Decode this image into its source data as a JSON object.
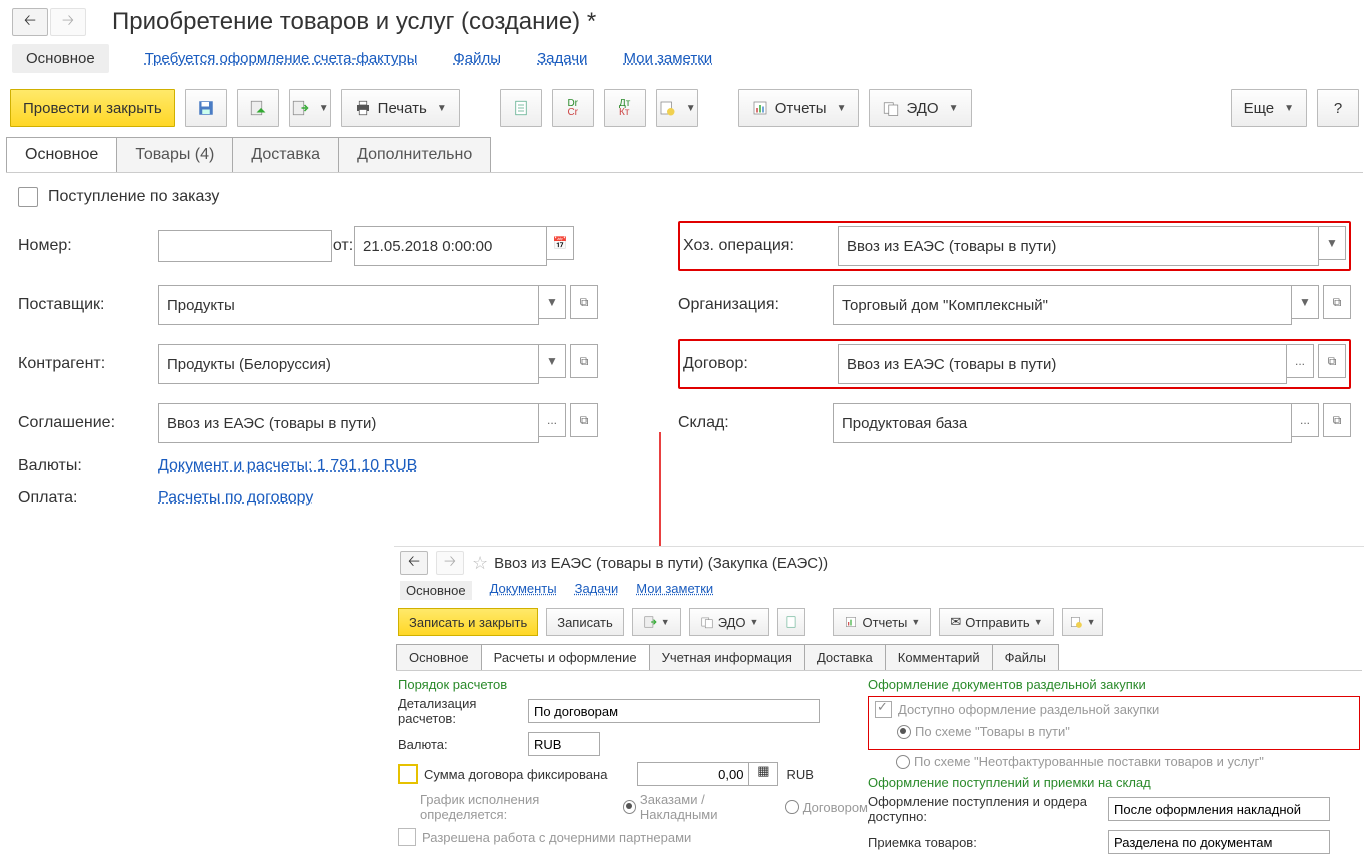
{
  "title": "Приобретение товаров и услуг (создание) *",
  "topNav": {
    "main": "Основное",
    "links": [
      "Требуется оформление счета-фактуры",
      "Файлы",
      "Задачи",
      "Мои заметки"
    ]
  },
  "toolbar": {
    "post_close": "Провести и закрыть",
    "print": "Печать",
    "reports": "Отчеты",
    "edo": "ЭДО",
    "more": "Еще"
  },
  "tabs": [
    "Основное",
    "Товары (4)",
    "Доставка",
    "Дополнительно"
  ],
  "form": {
    "order_receipt": "Поступление по заказу",
    "number_lbl": "Номер:",
    "number": "",
    "from_lbl": "от:",
    "date": "21.05.2018  0:00:00",
    "supplier_lbl": "Поставщик:",
    "supplier": "Продукты",
    "counterparty_lbl": "Контрагент:",
    "counterparty": "Продукты (Белоруссия)",
    "agreement_lbl": "Соглашение:",
    "agreement": "Ввоз из ЕАЭС (товары в пути)",
    "op_lbl": "Хоз. операция:",
    "op": "Ввоз из ЕАЭС (товары в пути)",
    "org_lbl": "Организация:",
    "org": "Торговый дом \"Комплексный\"",
    "contract_lbl": "Договор:",
    "contract": "Ввоз из ЕАЭС (товары в пути)",
    "warehouse_lbl": "Склад:",
    "warehouse": "Продуктовая база",
    "currency_lbl": "Валюты:",
    "currency_link": "Документ и расчеты: 1 791,10 RUB",
    "payment_lbl": "Оплата:",
    "payment_link": "Расчеты по договору"
  },
  "sub": {
    "title": "Ввоз из ЕАЭС (товары в пути) (Закупка (ЕАЭС))",
    "nav": {
      "main": "Основное",
      "links": [
        "Документы",
        "Задачи",
        "Мои заметки"
      ]
    },
    "toolbar": {
      "save_close": "Записать и закрыть",
      "save": "Записать",
      "edo": "ЭДО",
      "reports": "Отчеты",
      "send": "Отправить"
    },
    "tabs": [
      "Основное",
      "Расчеты и оформление",
      "Учетная информация",
      "Доставка",
      "Комментарий",
      "Файлы"
    ],
    "left": {
      "h1": "Порядок расчетов",
      "detail_lbl": "Детализация расчетов:",
      "detail": "По договорам",
      "curr_lbl": "Валюта:",
      "curr": "RUB",
      "sum_fixed": "Сумма договора фиксирована",
      "sum": "0,00",
      "sum_curr": "RUB",
      "schedule_lbl": "График исполнения определяется:",
      "schedule_opt1": "Заказами / Накладными",
      "schedule_opt2": "Договором",
      "child": "Разрешена работа с дочерними партнерами"
    },
    "right": {
      "h1": "Оформление документов раздельной закупки",
      "avail": "Доступно оформление раздельной закупки",
      "scheme1": "По схеме \"Товары в пути\"",
      "scheme2": "По схеме \"Неотфактурованные поставки товаров и услуг\"",
      "h2": "Оформление поступлений и приемки на склад",
      "order_avail_lbl": "Оформление поступления и ордера доступно:",
      "order_avail": "После оформления накладной",
      "accept_lbl": "Приемка товаров:",
      "accept": "Разделена по документам"
    }
  }
}
